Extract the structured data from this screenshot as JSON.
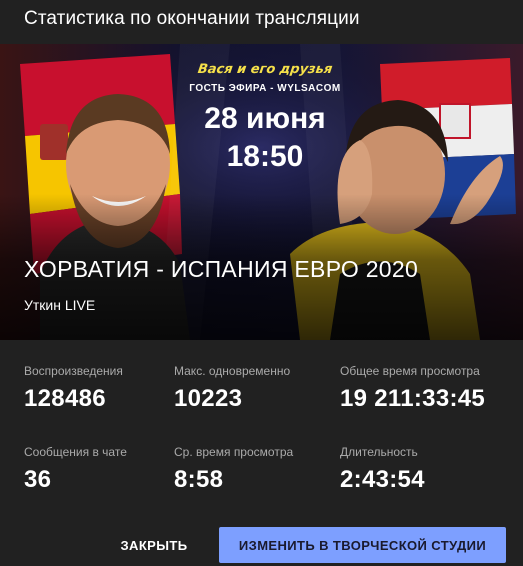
{
  "dialog": {
    "title": "Статистика по окончании трансляции"
  },
  "thumbnail": {
    "promo_line1": "Вася и его друзья",
    "promo_line2": "ГОСТЬ ЭФИРА - WYLSACOM",
    "promo_date": "28 июня",
    "promo_time": "18:50"
  },
  "video": {
    "title": "ХОРВАТИЯ - ИСПАНИЯ ЕВРО 2020",
    "channel": "Уткин LIVE"
  },
  "stats": [
    {
      "label": "Воспроизведения",
      "value": "128486"
    },
    {
      "label": "Макс. одновременно",
      "value": "10223"
    },
    {
      "label": "Общее время просмотра",
      "value": "19 211:33:45"
    },
    {
      "label": "Сообщения в чате",
      "value": "36"
    },
    {
      "label": "Ср. время просмотра",
      "value": "8:58"
    },
    {
      "label": "Длительность",
      "value": "2:43:54"
    }
  ],
  "actions": {
    "close_label": "ЗАКРЫТЬ",
    "studio_label": "ИЗМЕНИТЬ В ТВОРЧЕСКОЙ СТУДИИ"
  },
  "colors": {
    "background": "#212121",
    "accent_button": "#7d9fff",
    "label_grey": "#aaaaaa"
  }
}
